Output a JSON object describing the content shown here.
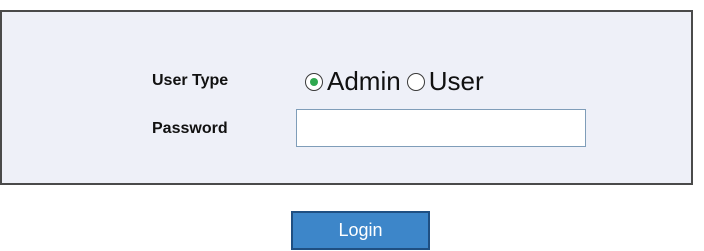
{
  "form": {
    "user_type_label": "User Type",
    "password_label": "Password",
    "user_type_options": [
      {
        "label": "Admin",
        "selected": true
      },
      {
        "label": "User",
        "selected": false
      }
    ],
    "password_value": "",
    "password_placeholder": ""
  },
  "actions": {
    "login_label": "Login"
  },
  "colors": {
    "panel_background": "#eef0f8",
    "button_background": "#3d86c9",
    "radio_selected_dot": "#2fa84f"
  }
}
